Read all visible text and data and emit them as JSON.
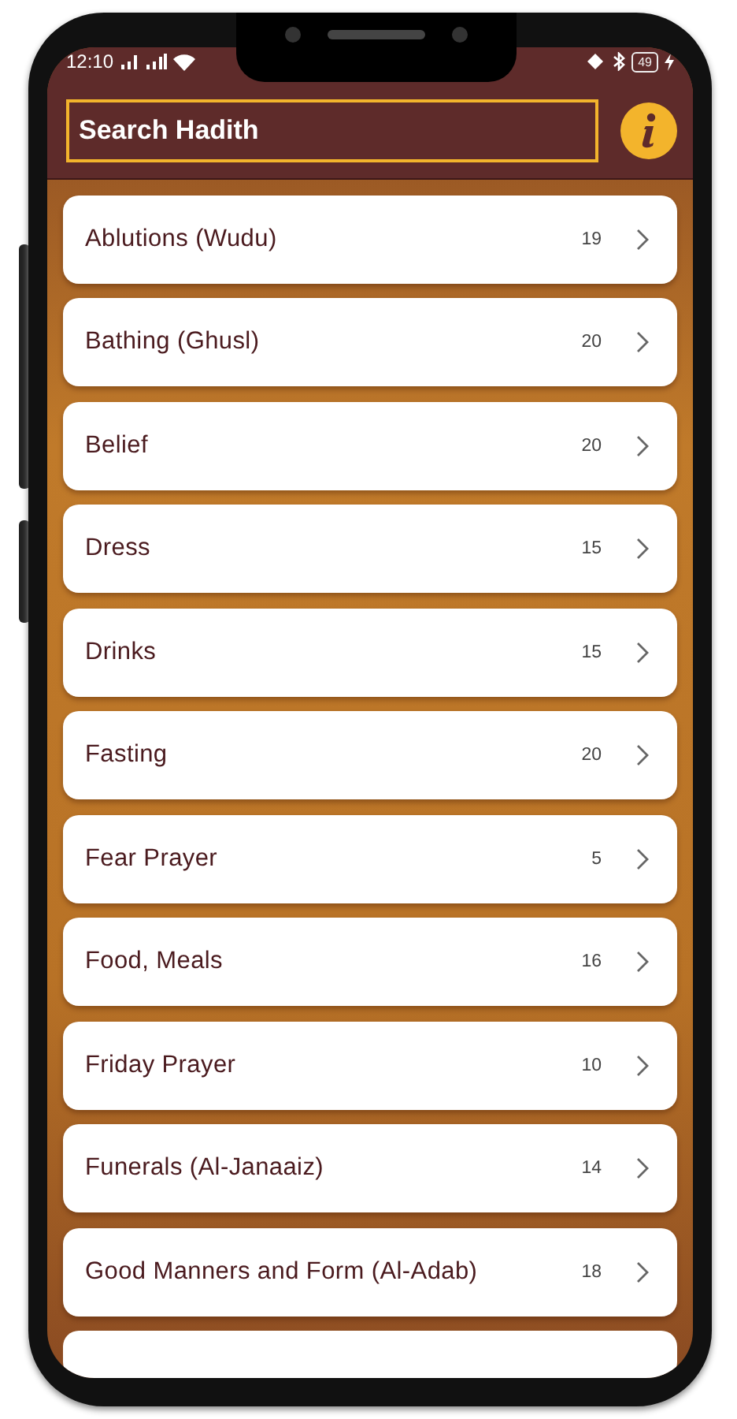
{
  "status_bar": {
    "time": "12:10",
    "battery": "49"
  },
  "search": {
    "placeholder": "Search Hadith"
  },
  "chapters": [
    {
      "title": "Ablutions (Wudu)",
      "count": "19"
    },
    {
      "title": "Bathing (Ghusl)",
      "count": "20"
    },
    {
      "title": "Belief",
      "count": "20"
    },
    {
      "title": "Dress",
      "count": "15"
    },
    {
      "title": "Drinks",
      "count": "15"
    },
    {
      "title": "Fasting",
      "count": "20"
    },
    {
      "title": "Fear Prayer",
      "count": "5"
    },
    {
      "title": "Food, Meals",
      "count": "16"
    },
    {
      "title": "Friday Prayer",
      "count": "10"
    },
    {
      "title": "Funerals (Al-Janaaiz)",
      "count": "14"
    },
    {
      "title": "Good Manners and Form (Al-Adab)",
      "count": "18"
    }
  ]
}
